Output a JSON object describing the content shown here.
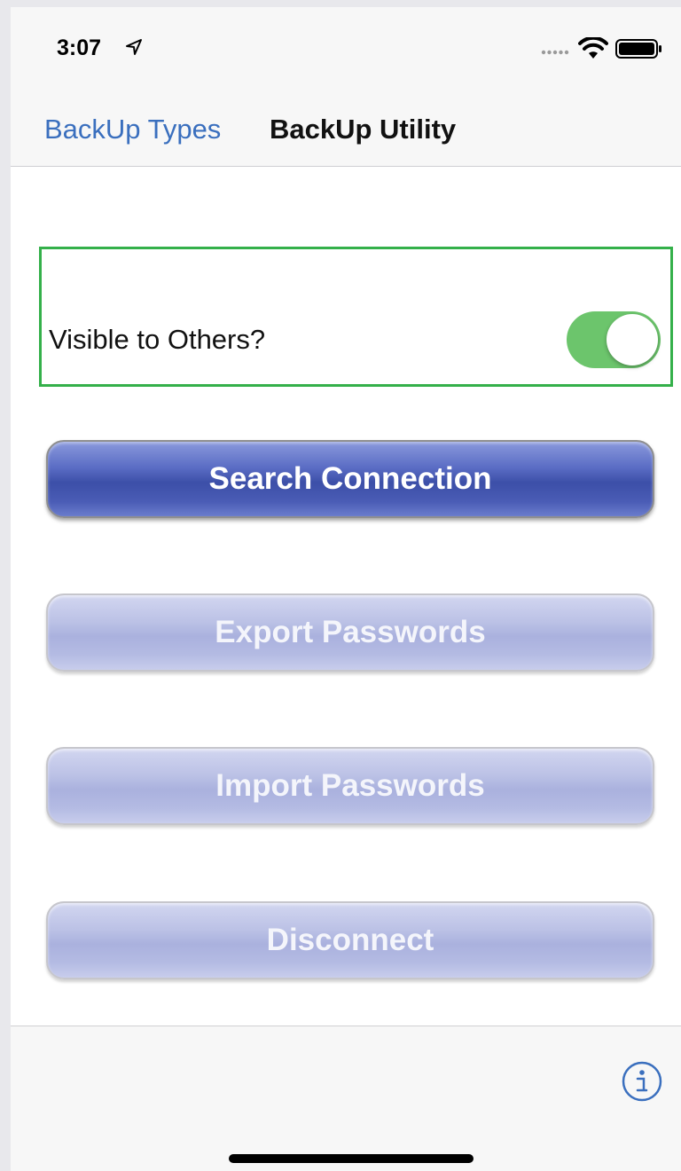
{
  "status_bar": {
    "time": "3:07",
    "location_icon": "location-arrow-icon",
    "signal_icon": "signal-dots-icon",
    "wifi_icon": "wifi-icon",
    "battery_icon": "battery-icon"
  },
  "nav": {
    "back_label": "BackUp Types",
    "title": "BackUp Utility"
  },
  "toggle": {
    "label": "Visible to Others?",
    "state": "on",
    "color": "#6cc56c"
  },
  "buttons": {
    "search": "Search Connection",
    "export": "Export Passwords",
    "import": "Import Passwords",
    "disconnect": "Disconnect"
  },
  "toolbar": {
    "info_icon": "info-icon"
  },
  "colors": {
    "accent": "#3a6fbe",
    "highlight_border": "#34b04a",
    "primary_button": "#4a5cb5",
    "disabled_button": "#b4bbe3"
  }
}
